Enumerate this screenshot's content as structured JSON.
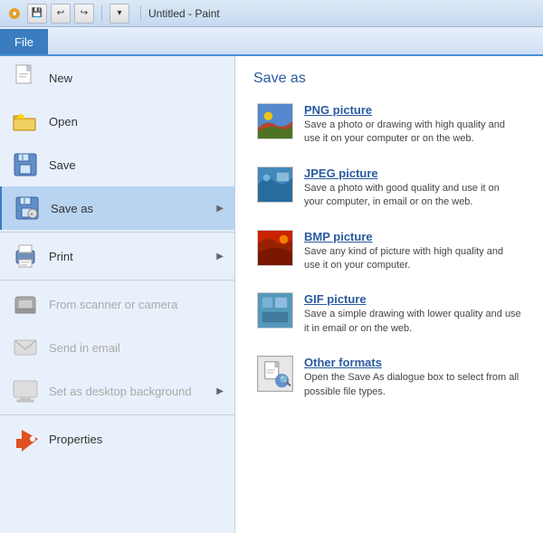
{
  "titlebar": {
    "title": "Untitled - Paint"
  },
  "ribbon": {
    "file_tab": "File"
  },
  "left_menu": {
    "items": [
      {
        "id": "new",
        "label": "New",
        "has_arrow": false,
        "disabled": false
      },
      {
        "id": "open",
        "label": "Open",
        "has_arrow": false,
        "disabled": false
      },
      {
        "id": "save",
        "label": "Save",
        "has_arrow": false,
        "disabled": false
      },
      {
        "id": "save-as",
        "label": "Save as",
        "has_arrow": true,
        "disabled": false,
        "active": true
      },
      {
        "id": "print",
        "label": "Print",
        "has_arrow": true,
        "disabled": false
      },
      {
        "id": "scanner",
        "label": "From scanner or camera",
        "has_arrow": false,
        "disabled": true
      },
      {
        "id": "email",
        "label": "Send in email",
        "has_arrow": false,
        "disabled": true
      },
      {
        "id": "desktop-bg",
        "label": "Set as desktop background",
        "has_arrow": true,
        "disabled": true
      },
      {
        "id": "properties",
        "label": "Properties",
        "has_arrow": false,
        "disabled": false
      }
    ]
  },
  "right_panel": {
    "title": "Save as",
    "formats": [
      {
        "id": "png",
        "name": "PNG picture",
        "description": "Save a photo or drawing with high quality and use it on your computer or on the web."
      },
      {
        "id": "jpeg",
        "name": "JPEG picture",
        "description": "Save a photo with good quality and use it on your computer, in email or on the web."
      },
      {
        "id": "bmp",
        "name": "BMP picture",
        "description": "Save any kind of picture with high quality and use it on your computer."
      },
      {
        "id": "gif",
        "name": "GIF picture",
        "description": "Save a simple drawing with lower quality and use it in email or on the web."
      },
      {
        "id": "other",
        "name": "Other formats",
        "description": "Open the Save As dialogue box to select from all possible file types."
      }
    ]
  }
}
